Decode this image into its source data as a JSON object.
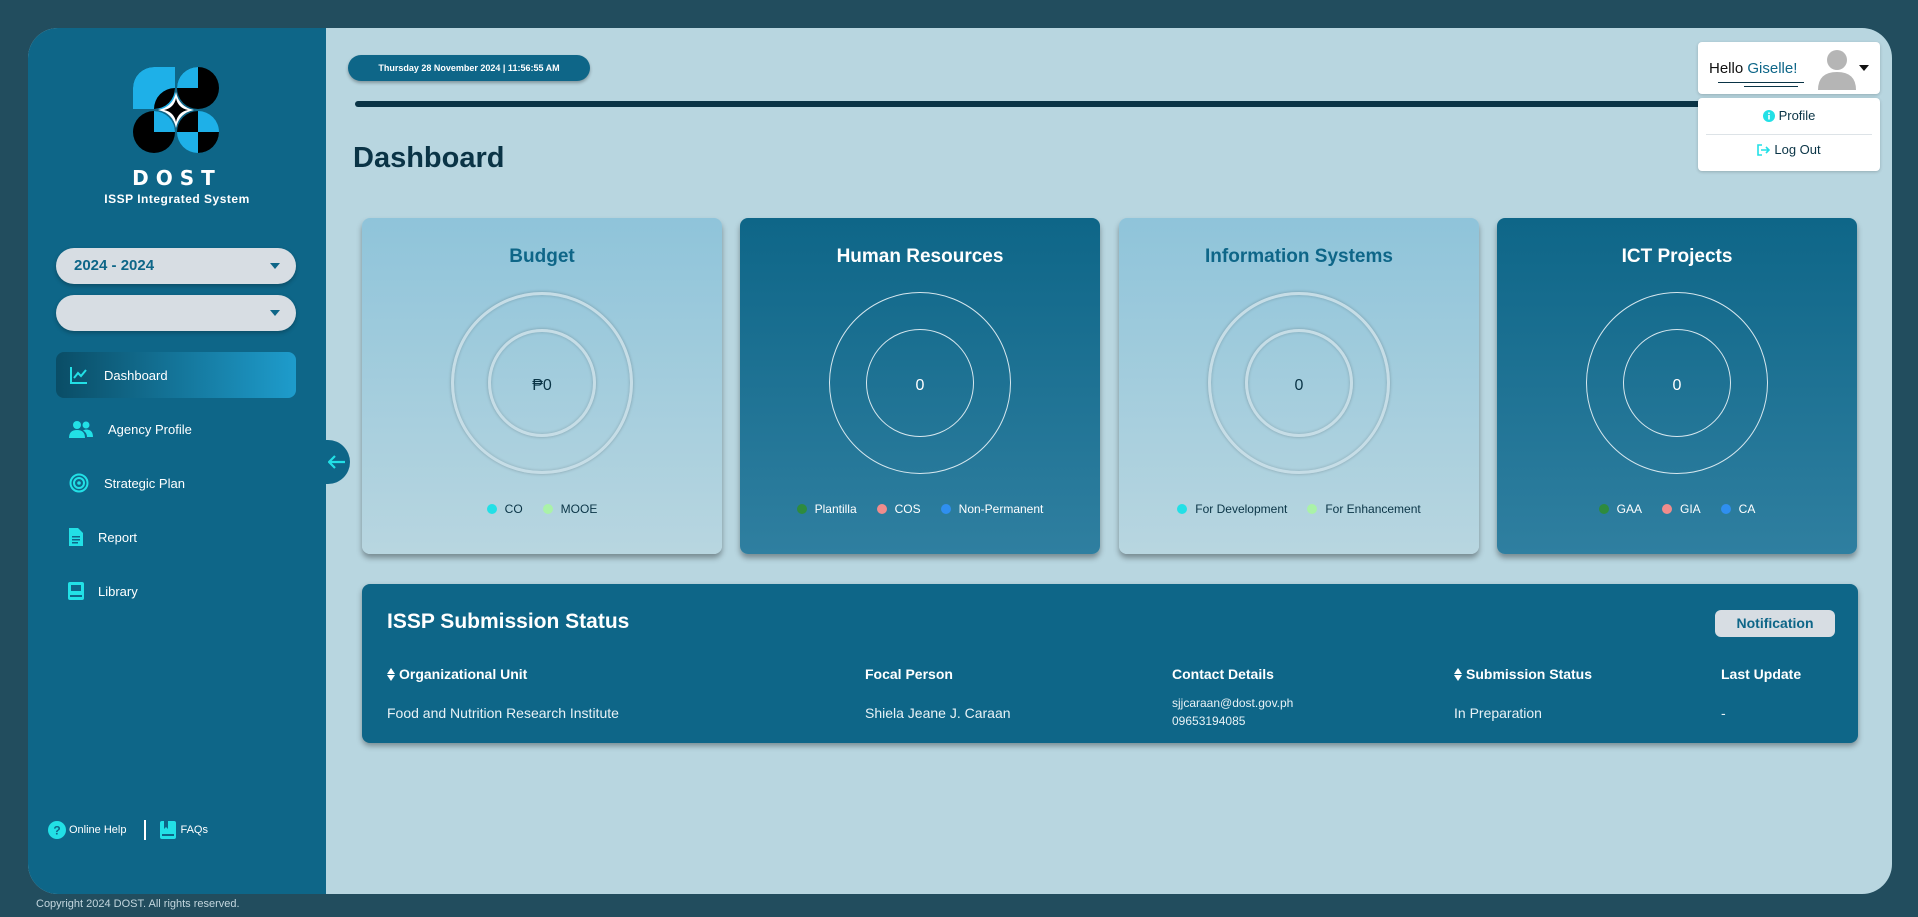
{
  "brand": {
    "name": "DOST",
    "subtitle": "ISSP Integrated System"
  },
  "filters": {
    "year_range": "2024 - 2024",
    "second_select": ""
  },
  "nav": {
    "items": [
      {
        "label": "Dashboard",
        "icon": "chart-line-icon",
        "active": true
      },
      {
        "label": "Agency Profile",
        "icon": "users-icon"
      },
      {
        "label": "Strategic Plan",
        "icon": "target-icon"
      },
      {
        "label": "Report",
        "icon": "document-icon"
      },
      {
        "label": "Library",
        "icon": "book-icon"
      }
    ]
  },
  "help": {
    "online_help": "Online Help",
    "faqs": "FAQs"
  },
  "header": {
    "datetime": "Thursday 28 November 2024 | 11:56:55 AM",
    "page_title": "Dashboard",
    "user": {
      "greeting": "Hello",
      "name": "Giselle!"
    },
    "menu": {
      "profile": "Profile",
      "logout": "Log Out"
    }
  },
  "cards": [
    {
      "title": "Budget",
      "value": "₱0",
      "legend": [
        {
          "label": "CO",
          "color": "#22e0e6"
        },
        {
          "label": "MOOE",
          "color": "#aaf2a8"
        }
      ]
    },
    {
      "title": "Human Resources",
      "value": "0",
      "legend": [
        {
          "label": "Plantilla",
          "color": "#2e8b3e"
        },
        {
          "label": "COS",
          "color": "#f08c8c"
        },
        {
          "label": "Non-Permanent",
          "color": "#2f8ff0"
        }
      ]
    },
    {
      "title": "Information Systems",
      "value": "0",
      "legend": [
        {
          "label": "For Development",
          "color": "#22e0e6"
        },
        {
          "label": "For Enhancement",
          "color": "#aaf2a8"
        }
      ]
    },
    {
      "title": "ICT Projects",
      "value": "0",
      "legend": [
        {
          "label": "GAA",
          "color": "#2e8b3e"
        },
        {
          "label": "GIA",
          "color": "#f08c8c"
        },
        {
          "label": "CA",
          "color": "#2f8ff0"
        }
      ]
    }
  ],
  "status": {
    "title": "ISSP Submission Status",
    "notification_label": "Notification",
    "columns": [
      "Organizational Unit",
      "Focal Person",
      "Contact Details",
      "Submission Status",
      "Last Update"
    ],
    "rows": [
      {
        "unit": "Food and Nutrition Research Institute",
        "person": "Shiela Jeane J. Caraan",
        "email": "sjjcaraan@dost.gov.ph",
        "phone": "09653194085",
        "status": "In Preparation",
        "last_update": "-"
      }
    ]
  },
  "footer": {
    "copyright": "Copyright 2024 DOST. All rights reserved."
  },
  "colors": {
    "sidebar": "#0e6688",
    "background": "#b8d6e0",
    "accent_dark": "#0a3446",
    "icon_accent": "#22e0e6"
  }
}
